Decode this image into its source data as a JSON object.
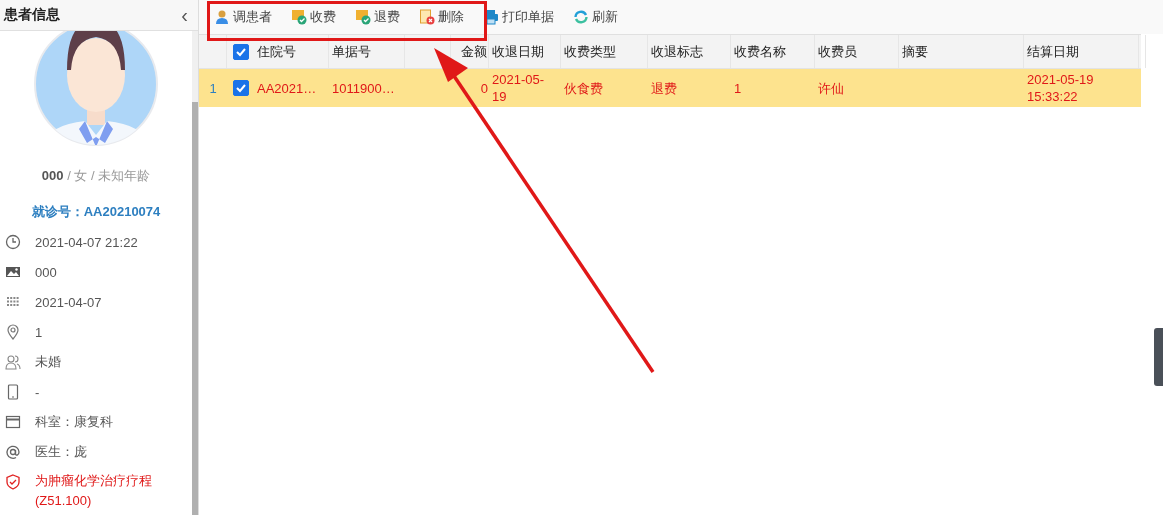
{
  "sidebar": {
    "title": "患者信息",
    "collapse_icon": "‹",
    "patient": {
      "name": "000",
      "details": " / 女 / 未知年龄",
      "visit_label": "就诊号：AA20210074"
    },
    "items": [
      {
        "kind": "clock",
        "text": "2021-04-07 21:22"
      },
      {
        "kind": "image",
        "text": "000"
      },
      {
        "kind": "calendar",
        "text": "2021-04-07"
      },
      {
        "kind": "pin",
        "text": "1"
      },
      {
        "kind": "person",
        "text": "未婚"
      },
      {
        "kind": "phone",
        "text": "-"
      },
      {
        "kind": "window",
        "text": "科室：康复科"
      },
      {
        "kind": "at",
        "text": "医生：庞"
      },
      {
        "kind": "shield",
        "text": "为肿瘤化学治疗疗程(Z51.100)",
        "alert": true
      }
    ]
  },
  "toolbar": [
    {
      "kind": "patient",
      "label": "调患者"
    },
    {
      "kind": "charge",
      "label": "收费"
    },
    {
      "kind": "refund",
      "label": "退费"
    },
    {
      "kind": "delete",
      "label": "删除"
    },
    {
      "kind": "print",
      "label": "打印单据"
    },
    {
      "kind": "refresh",
      "label": "刷新"
    }
  ],
  "table": {
    "all_checked": true,
    "columns": [
      "住院号",
      "单据号",
      "",
      "金额",
      "收退日期",
      "收费类型",
      "收退标志",
      "收费名称",
      "收费员",
      "摘要",
      "结算日期"
    ],
    "rows": [
      {
        "row_number": "1",
        "selected": true,
        "checked": true,
        "cells": [
          "AA2021…",
          "1011900…",
          "",
          "0",
          "2021-05-19",
          "伙食费",
          "退费",
          "1",
          "许仙",
          "",
          "2021-05-19 15:33:22"
        ]
      }
    ]
  },
  "annotation": {
    "highlight": true,
    "arrow": true
  }
}
